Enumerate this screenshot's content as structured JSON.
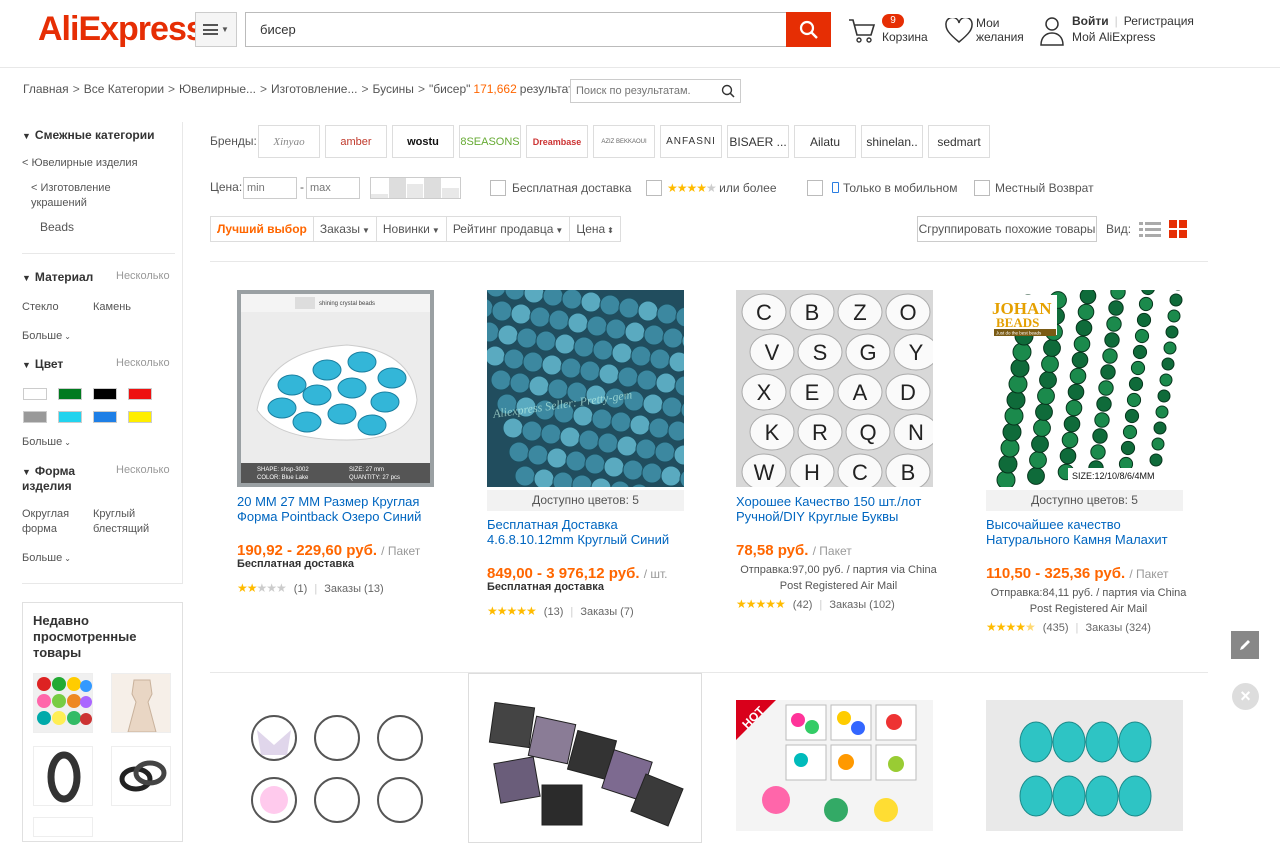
{
  "header": {
    "logo": "AliExpress",
    "search_value": "бисер",
    "cart_count": "9",
    "cart_label": "Корзина",
    "wishlist_label_1": "Мои",
    "wishlist_label_2": "желания",
    "signin": "Войти",
    "register": "Регистрация",
    "my_account": "Мой AliExpress"
  },
  "breadcrumb": {
    "items": [
      "Главная",
      "Все Категории",
      "Ювелирные...",
      "Изготовление...",
      "Бусины",
      "\"бисер\""
    ],
    "count": "171,662",
    "results_label": "результатов",
    "search_placeholder": "Поиск по результатам."
  },
  "sidebar": {
    "related_title": "Смежные категории",
    "related_items": [
      "< Ювелирные изделия",
      "< Изготовление украшений",
      "Beads"
    ],
    "material_title": "Материал",
    "material_multi": "Несколько",
    "material_items": [
      "Стекло",
      "Камень"
    ],
    "more": "Больше",
    "color_title": "Цвет",
    "color_multi": "Несколько",
    "colors": [
      "#ffffff",
      "#007a1f",
      "#000000",
      "#ee1111",
      "#999999",
      "#22d3ee",
      "#1e7fe6",
      "#ffee00"
    ],
    "shape_title": "Форма изделия",
    "shape_multi": "Несколько",
    "shape_items": [
      "Округлая форма",
      "Круглый блестящий"
    ],
    "recent_title": "Недавно просмотренные товары"
  },
  "filters": {
    "brands_label": "Бренды:",
    "brands": [
      "Xinyao",
      "amber",
      "wostu",
      "8SEASONS",
      "Dreambase",
      "AZIZ BEKKAOUI",
      "ANFASNI",
      "BISAER ...",
      "Ailatu",
      "shinelan..",
      "sedmart"
    ],
    "price_label": "Цена:",
    "price_min": "min",
    "price_max": "max",
    "free_shipping": "Бесплатная доставка",
    "rating_more": "или более",
    "mobile_only": "Только в мобильном",
    "local_return": "Местный Возврат",
    "sort": [
      "Лучший выбор",
      "Заказы",
      "Новинки",
      "Рейтинг продавца",
      "Цена"
    ],
    "group_similar": "Сгруппировать похожие товары",
    "view_label": "Вид:"
  },
  "products": [
    {
      "title": "20 ММ 27 ММ Размер Круглая Форма Pointback Озеро Синий",
      "price": "190,92 - 229,60 руб.",
      "unit": "/ Пакет",
      "shipping": "Бесплатная доставка",
      "rating": 2,
      "reviews": "(1)",
      "orders": "Заказы (13)",
      "colors": ""
    },
    {
      "title": "Бесплатная Доставка 4.6.8.10.12mm Круглый Синий",
      "price": "849,00 - 3 976,12 руб.",
      "unit": "/ шт.",
      "shipping": "Бесплатная доставка",
      "rating": 5,
      "reviews": "(13)",
      "orders": "Заказы (7)",
      "colors": "Доступно цветов: 5"
    },
    {
      "title": "Хорошее Качество 150 шт./лот Ручной/DIY Круглые Буквы",
      "price": "78,58 руб.",
      "unit": "/ Пакет",
      "shipping": "Отправка:97,00 руб. / партия via China Post Registered Air Mail",
      "rating": 5,
      "reviews": "(42)",
      "orders": "Заказы (102)",
      "colors": ""
    },
    {
      "title": "Высочайшее качество Натурального Камня Малахит",
      "price": "110,50 - 325,36 руб.",
      "unit": "/ Пакет",
      "shipping": "Отправка:84,11 руб. / партия via China Post Registered Air Mail",
      "rating": 4.5,
      "reviews": "(435)",
      "orders": "Заказы (324)",
      "colors": "Доступно цветов: 5"
    }
  ],
  "image_text": {
    "p1_header": "shining crystal beads",
    "p1_shape": "SHAPE: shsp-3002",
    "p1_color": "COLOR: Blue Lake",
    "p1_size": "SIZE:   27 mm",
    "p1_qty": "QUANTITY: 27 pcs",
    "p2_watermark": "Aliexpress Seller: Pretty-gem",
    "p4_brand1": "JOHAN",
    "p4_brand2": "BEADS",
    "p4_sub": "Just do the best beads",
    "p4_size": "SIZE:12/10/8/6/4MM",
    "p7_hot": "HOT"
  },
  "accent": "#e62e04"
}
